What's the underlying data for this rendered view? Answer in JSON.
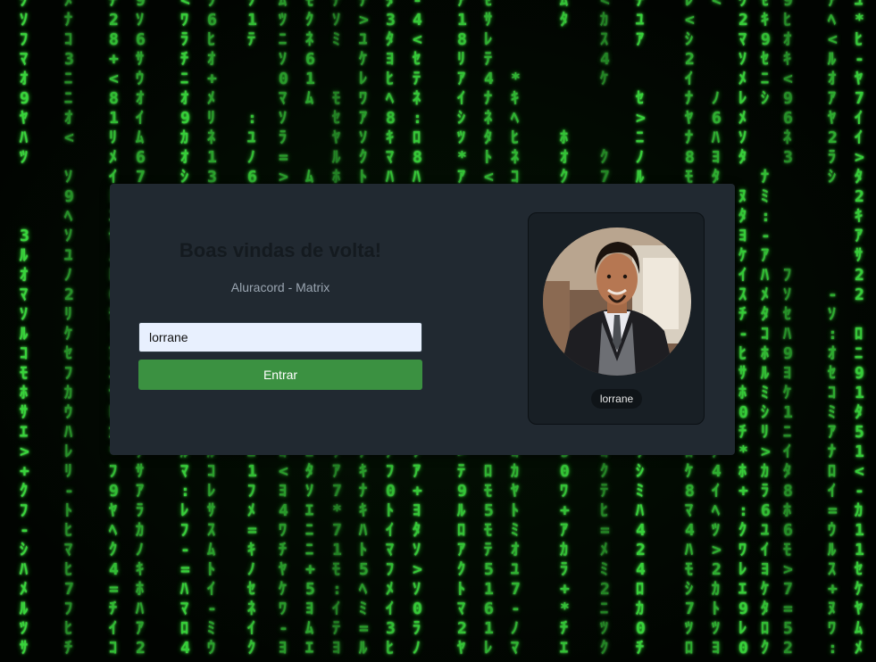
{
  "background": {
    "style": "matrix-digital-rain",
    "color": "#39d83c"
  },
  "login": {
    "title": "Boas vindas de volta!",
    "subtitle": "Aluracord - Matrix",
    "username_value": "lorrane",
    "submit_label": "Entrar"
  },
  "profile": {
    "username": "lorrane"
  },
  "colors": {
    "card": "#212931",
    "button": "#3b9141",
    "panel": "#181f25"
  }
}
